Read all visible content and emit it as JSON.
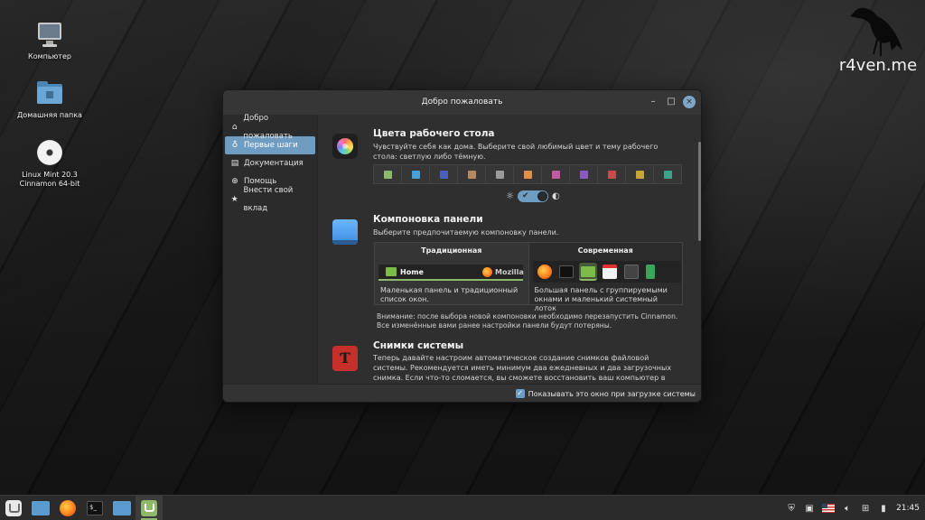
{
  "desktop": {
    "icons": [
      {
        "label": "Компьютер"
      },
      {
        "label": "Домашняя папка"
      },
      {
        "label_line1": "Linux Mint 20.3",
        "label_line2": "Cinnamon 64-bit"
      }
    ],
    "watermark": "r4ven.me"
  },
  "window": {
    "title": "Добро пожаловать",
    "controls": {
      "minimize": "–",
      "maximize": "□",
      "close": "×"
    },
    "sidebar": {
      "items": [
        {
          "label": "Добро пожаловать",
          "icon": "home-icon"
        },
        {
          "label": "Первые шаги",
          "icon": "bulb-icon",
          "active": true
        },
        {
          "label": "Документация",
          "icon": "book-icon"
        },
        {
          "label": "Помощь",
          "icon": "lifebuoy-icon"
        },
        {
          "label": "Внести свой вклад",
          "icon": "star-icon"
        }
      ]
    },
    "sections": {
      "colors": {
        "title": "Цвета рабочего стола",
        "desc": "Чувствуйте себя как дома. Выберите свой любимый цвет и тему рабочего стола: светлую либо тёмную.",
        "swatches": [
          "#8fb96a",
          "#4a9fd4",
          "#4a5fc1",
          "#b58a63",
          "#9a9a9a",
          "#e0904a",
          "#c45a9f",
          "#8a5ac4",
          "#c94a4a",
          "#c9a43a",
          "#3aa58a"
        ],
        "theme_toggle": {
          "light_icon": "☼",
          "dark_icon": "◐",
          "check": "✔"
        }
      },
      "layout": {
        "title": "Компоновка панели",
        "desc": "Выберите предпочитаемую компоновку панели.",
        "options": [
          {
            "title": "Традиционная",
            "desc": "Маленькая панель и традиционный список окон.",
            "preview_home": "Home",
            "preview_moz": "Mozilla"
          },
          {
            "title": "Современная",
            "desc": "Большая панель с группируемыми окнами и маленький системный лоток"
          }
        ],
        "note": "Внимание: после выбора новой компоновки необходимо перезапустить Cinnamon. Все изменённые вами ранее настройки панели будут потеряны."
      },
      "snapshots": {
        "title": "Снимки системы",
        "desc": "Теперь давайте настроим автоматическое создание снимков файловой системы. Рекомендуется иметь минимум два ежедневных и два загрузочных снимка. Если что-то сломается, вы сможете восстановить ваш компьютер в прежнее рабочее состояние."
      }
    },
    "footer": {
      "checkbox_label": "Показывать это окно при загрузке системы",
      "checked": true
    }
  },
  "taskbar": {
    "apps": [
      "menu",
      "files",
      "firefox",
      "terminal",
      "files",
      "welcome"
    ],
    "clock": "21:45"
  }
}
